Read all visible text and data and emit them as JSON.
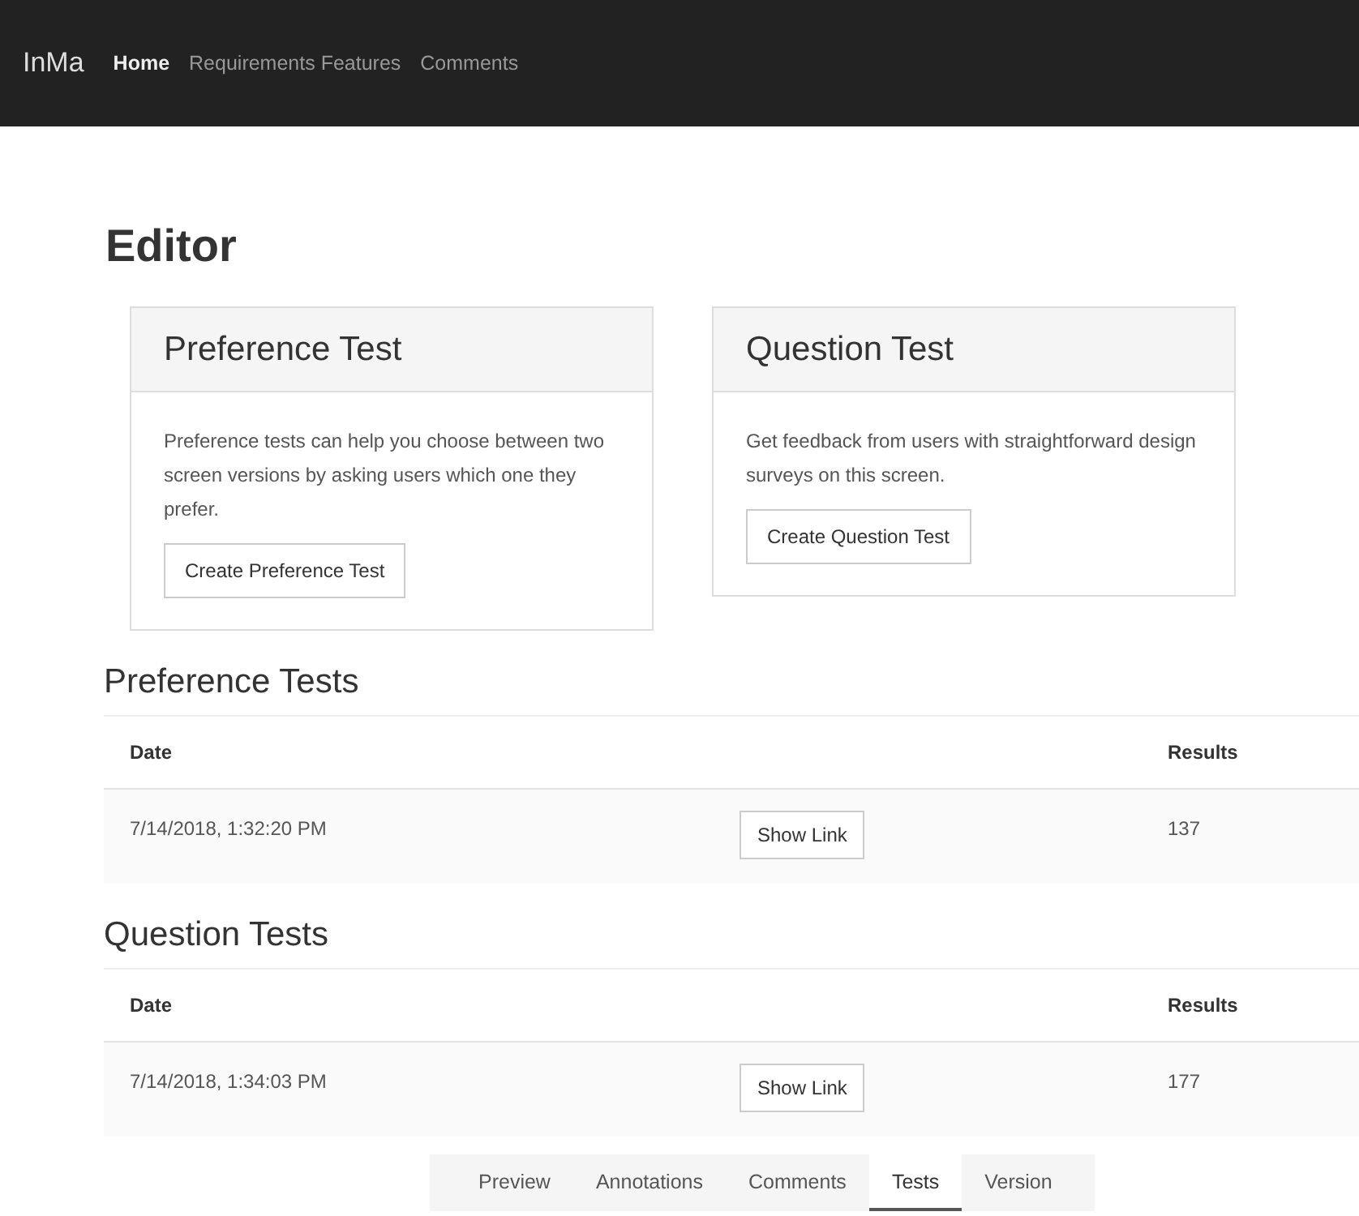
{
  "navbar": {
    "brand": "InMa",
    "items": [
      {
        "label": "Home",
        "selected": true
      },
      {
        "label": "Requirements Features",
        "selected": false
      },
      {
        "label": "Comments",
        "selected": false
      }
    ]
  },
  "page_title": "Editor",
  "cards": [
    {
      "title": "Preference Test",
      "text": "Preference tests can help you choose between two screen versions by asking users which one they prefer.",
      "button": "Create Preference Test"
    },
    {
      "title": "Question Test",
      "text": "Get feedback from users with straightforward design surveys on this screen.",
      "button": "Create Question Test"
    }
  ],
  "sections": [
    {
      "title": "Preference Tests",
      "columns": [
        "Date",
        "Results"
      ],
      "rows": [
        {
          "date": "7/14/2018, 1:32:20 PM",
          "button": "Show Link",
          "results": "137"
        }
      ]
    },
    {
      "title": "Question Tests",
      "columns": [
        "Date",
        "Results"
      ],
      "rows": [
        {
          "date": "7/14/2018, 1:34:03 PM",
          "button": "Show Link",
          "results": "177"
        }
      ]
    }
  ],
  "bottom_tabs": [
    {
      "label": "Preview",
      "selected": false
    },
    {
      "label": "Annotations",
      "selected": false
    },
    {
      "label": "Comments",
      "selected": false
    },
    {
      "label": "Tests",
      "selected": true
    },
    {
      "label": "Version",
      "selected": false
    }
  ]
}
